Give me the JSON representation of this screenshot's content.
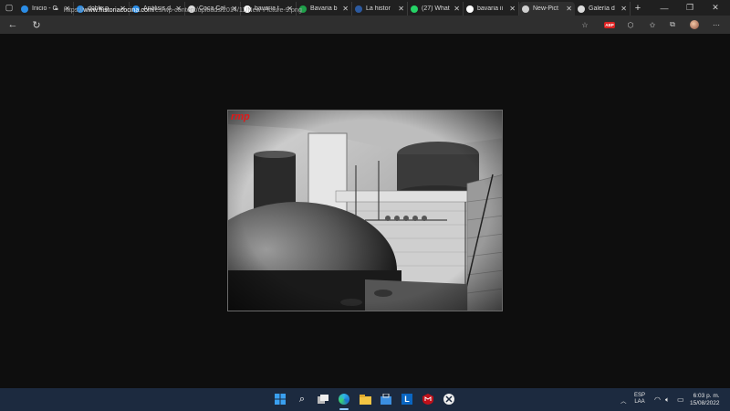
{
  "browser": {
    "tabs": [
      {
        "title": "Inicio - C",
        "favicon": "edge-icon",
        "color": "#2b8de6",
        "active": false
      },
      {
        "title": "doble p",
        "favicon": "edge-icon",
        "color": "#2b8de6",
        "active": false
      },
      {
        "title": "Análisis d",
        "favicon": "edge-icon",
        "color": "#2b8de6",
        "active": false
      },
      {
        "title": "Coca Col",
        "favicon": "globe-icon",
        "color": "#dcdcdc",
        "active": false
      },
      {
        "title": "bavaria t",
        "favicon": "google-icon",
        "color": "#ffffff",
        "active": false
      },
      {
        "title": "Bavaria b",
        "favicon": "b-icon",
        "color": "#1fa14a",
        "active": false
      },
      {
        "title": "La histor",
        "favicon": "lh-icon",
        "color": "#2c5aa0",
        "active": false
      },
      {
        "title": "(27) What",
        "favicon": "whatsapp-icon",
        "color": "#25d366",
        "active": false
      },
      {
        "title": "bavaria ii",
        "favicon": "google-icon",
        "color": "#ffffff",
        "active": false
      },
      {
        "title": "New-Pict",
        "favicon": "document-icon",
        "color": "#cfcfcf",
        "active": true
      },
      {
        "title": "Galería d",
        "favicon": "globe-icon",
        "color": "#dcdcdc",
        "active": false
      }
    ],
    "new_tab_label": "+",
    "address": {
      "prefix": "https://",
      "host": "www.historiacocina.com",
      "path": "/es/wp-content/uploads/2014/11/New-Picture-9.png"
    },
    "abp_label": "ABP"
  },
  "image": {
    "watermark": "rmp",
    "description_alt": "New-Picture-9.png"
  },
  "taskbar": {
    "language": "ESP",
    "layout": "LAA",
    "time": "6:03 p. m.",
    "date": "15/08/2022"
  },
  "colors": {
    "tabbar": "#202020",
    "toolbar": "#2f2f2f",
    "viewport": "#0e0e0e",
    "taskbar": "#1c2a3f",
    "watermark": "#e01818"
  }
}
